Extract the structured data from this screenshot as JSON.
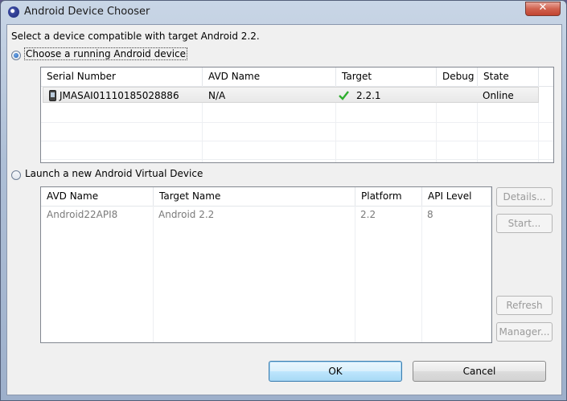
{
  "window": {
    "title": "Android Device Chooser",
    "close_glyph": "✕"
  },
  "prompt": "Select a device compatible with target Android 2.2.",
  "running": {
    "radio_label": "Choose a running Android device",
    "columns": [
      "Serial Number",
      "AVD Name",
      "Target",
      "Debug",
      "State"
    ],
    "rows": [
      {
        "serial": "JMASAI01110185028886",
        "avd_name": "N/A",
        "target": "2.2.1",
        "debug": "",
        "state": "Online",
        "device_icon": "phone-icon",
        "target_icon": "check-icon"
      }
    ]
  },
  "launch": {
    "radio_label": "Launch a new Android Virtual Device",
    "columns": [
      "AVD Name",
      "Target Name",
      "Platform",
      "API Level"
    ],
    "rows": [
      {
        "avd_name": "Android22API8",
        "target_name": "Android 2.2",
        "platform": "2.2",
        "api_level": "8"
      }
    ],
    "buttons": {
      "details": "Details...",
      "start": "Start...",
      "refresh": "Refresh",
      "manager": "Manager..."
    }
  },
  "footer": {
    "ok": "OK",
    "cancel": "Cancel"
  },
  "colors": {
    "check_green": "#2eae2e",
    "title_gradient": "#aebfd6",
    "close_red": "#c24430"
  }
}
